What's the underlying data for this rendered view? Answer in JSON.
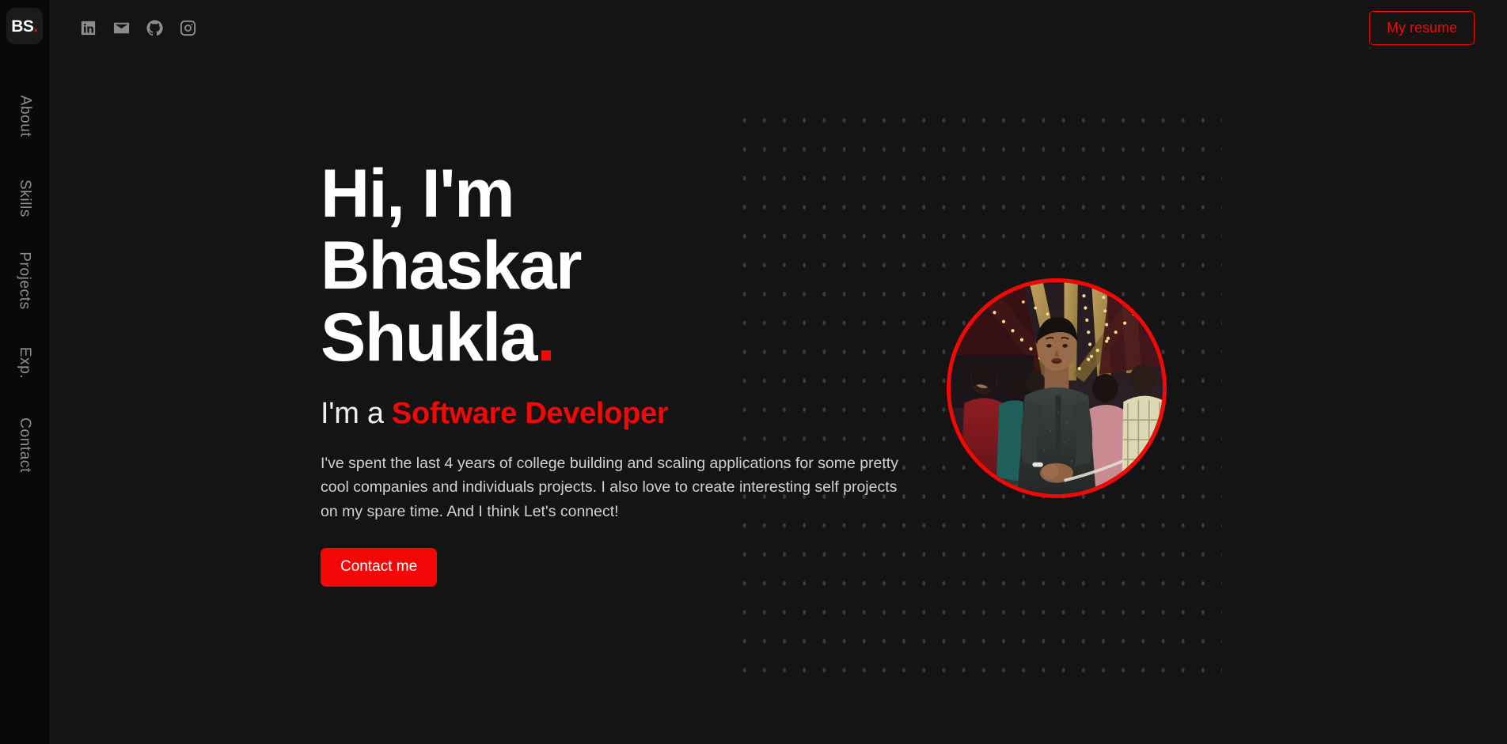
{
  "brand": {
    "logo_text": "BS",
    "logo_dot": "."
  },
  "sidebar": {
    "items": [
      {
        "label": "About",
        "name": "about"
      },
      {
        "label": "Skills",
        "name": "skills"
      },
      {
        "label": "Projects",
        "name": "projects"
      },
      {
        "label": "Exp.",
        "name": "exp"
      },
      {
        "label": "Contact",
        "name": "contact"
      }
    ]
  },
  "topbar": {
    "socials": [
      {
        "icon": "linkedin-icon",
        "label": "LinkedIn"
      },
      {
        "icon": "email-icon",
        "label": "Email"
      },
      {
        "icon": "github-icon",
        "label": "GitHub"
      },
      {
        "icon": "instagram-icon",
        "label": "Instagram"
      }
    ],
    "resume_label": "My resume"
  },
  "hero": {
    "title_line1": "Hi, I'm",
    "title_line2": "Bhaskar",
    "title_line3": "Shukla",
    "title_dot": ".",
    "sub_prefix": "I'm a ",
    "sub_role": "Software Developer",
    "paragraph": "I've spent the last 4 years of college building and scaling applications for some pretty cool companies and individuals projects. I also love to create interesting self projects on my spare time. And I think Let's connect!",
    "cta_label": "Contact me"
  },
  "photo": {
    "alt": "Portrait of Bhaskar Shukla standing at a decorated event venue"
  },
  "colors": {
    "accent": "#f50707",
    "page_background": "#141414",
    "sidebar_background": "#090909",
    "dot_grid": "#3a3a3a",
    "muted_text": "#8f8f8f",
    "body_text": "#d2d2d2"
  }
}
